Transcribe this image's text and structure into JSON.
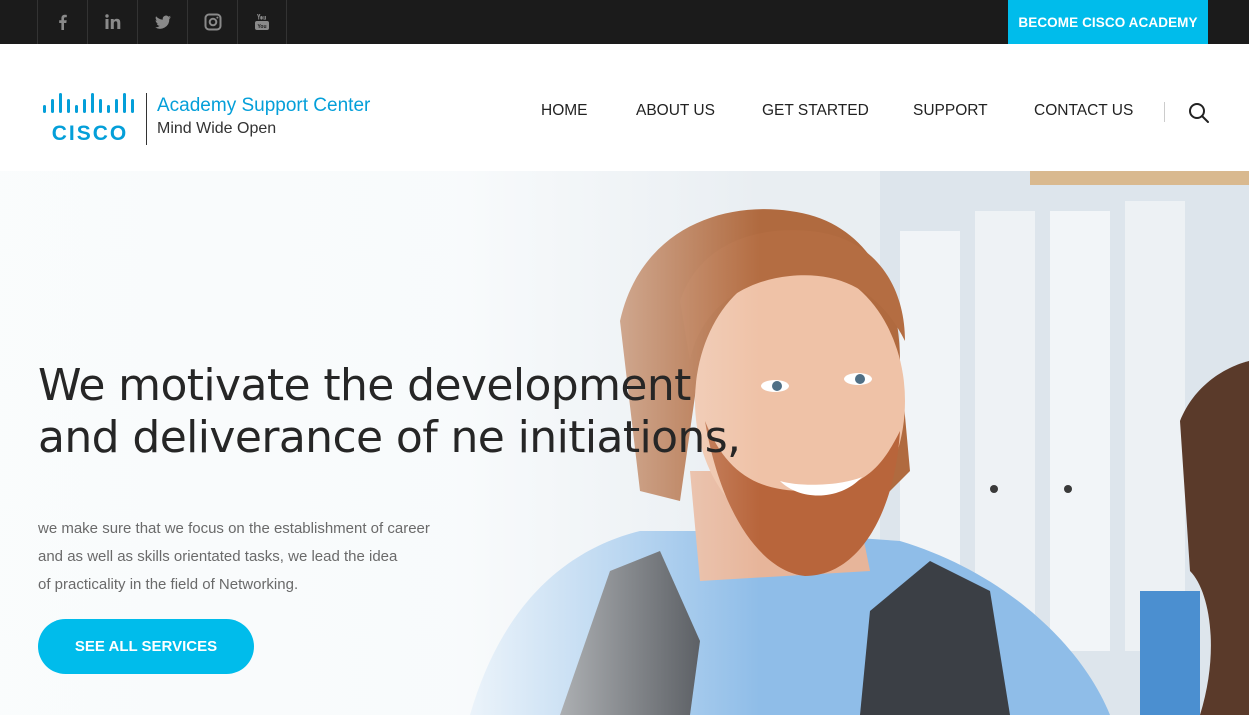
{
  "topbar": {
    "social": [
      {
        "icon": "facebook-icon",
        "glyph": "f"
      },
      {
        "icon": "linkedin-icon",
        "glyph": "in"
      },
      {
        "icon": "twitter-icon",
        "glyph": ""
      },
      {
        "icon": "instagram-icon",
        "glyph": ""
      },
      {
        "icon": "youtube-icon",
        "glyph": ""
      }
    ],
    "cta_label": "BECOME CISCO ACADEMY"
  },
  "header": {
    "logo_text": "CISCO",
    "brand_title": "Academy Support Center",
    "brand_tagline": "Mind Wide Open",
    "nav": [
      "HOME",
      "ABOUT US",
      "GET STARTED",
      "SUPPORT",
      "CONTACT US"
    ],
    "search_icon": "search-icon"
  },
  "hero": {
    "headline_line1": "We motivate the development",
    "headline_line2": "and deliverance of ne initiations,",
    "desc_line1": "we make sure that we focus on the establishment of career",
    "desc_line2": "and as well as skills orientated tasks, we lead the idea",
    "desc_line3": "of practicality in the field of Networking.",
    "cta_label": "SEE ALL SERVICES"
  },
  "colors": {
    "accent": "#00bceb",
    "brand_blue": "#049fd9",
    "topbar_bg": "#1b1b1b",
    "text_dark": "#262626"
  }
}
